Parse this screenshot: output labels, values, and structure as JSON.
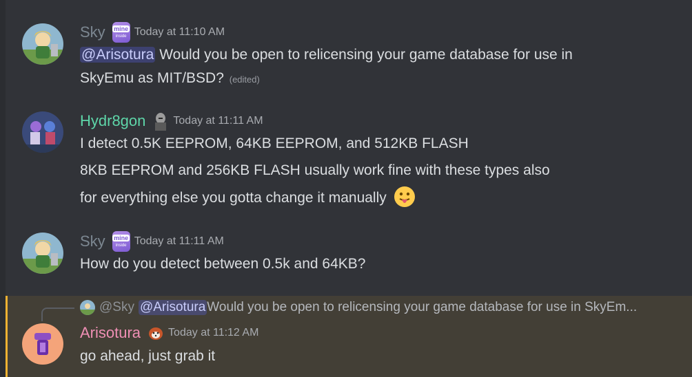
{
  "messages": [
    {
      "username": "Sky",
      "badge_text": "mine",
      "badge_sub": "inside",
      "timestamp": "Today at 11:10 AM",
      "mention": "@Arisotura",
      "line1_rest": " Would you be open to relicensing your game database for use in",
      "line2": "SkyEmu as MIT/BSD?",
      "edited": "(edited)"
    },
    {
      "username": "Hydr8gon",
      "timestamp": "Today at 11:11 AM",
      "lines": [
        "I detect 0.5K EEPROM, 64KB EEPROM, and 512KB FLASH",
        "8KB EEPROM and 256KB FLASH usually work fine with these types also",
        "for everything else you gotta change it manually"
      ],
      "emoji": "tongue-out-emoji"
    },
    {
      "username": "Sky",
      "badge_text": "mine",
      "badge_sub": "inside",
      "timestamp": "Today at 11:11 AM",
      "text": "How do you detect between 0.5k and 64KB?"
    },
    {
      "reply": {
        "author": "@Sky",
        "mention": "@Arisotura",
        "text": " Would you be open to relicensing your game database for use in SkyEm..."
      },
      "username": "Arisotura",
      "timestamp": "Today at 11:12 AM",
      "text": "go ahead, just grab it"
    }
  ],
  "colors": {
    "background": "#313338",
    "sky_name": "#7c8791",
    "hydr8gon_name": "#5ed6a9",
    "arisotura_name": "#ef8fb4",
    "mention_bg": "#3c4270",
    "highlight_bg": "#433f36",
    "highlight_bar": "#f0b232"
  }
}
